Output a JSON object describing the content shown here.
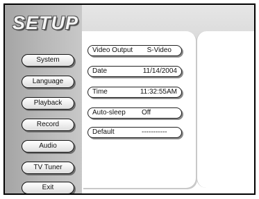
{
  "title": "SETUP",
  "menu": [
    "System",
    "Language",
    "Playback",
    "Record",
    "Audio",
    "TV Tuner",
    "Exit"
  ],
  "options": [
    {
      "label": "Video Output",
      "value": "S-Video"
    },
    {
      "label": "Date",
      "value": "11/14/2004"
    },
    {
      "label": "Time",
      "value": "11:32:55AM"
    },
    {
      "label": "Auto-sleep",
      "value": "Off"
    },
    {
      "label": "Default",
      "value": "-----------"
    }
  ]
}
